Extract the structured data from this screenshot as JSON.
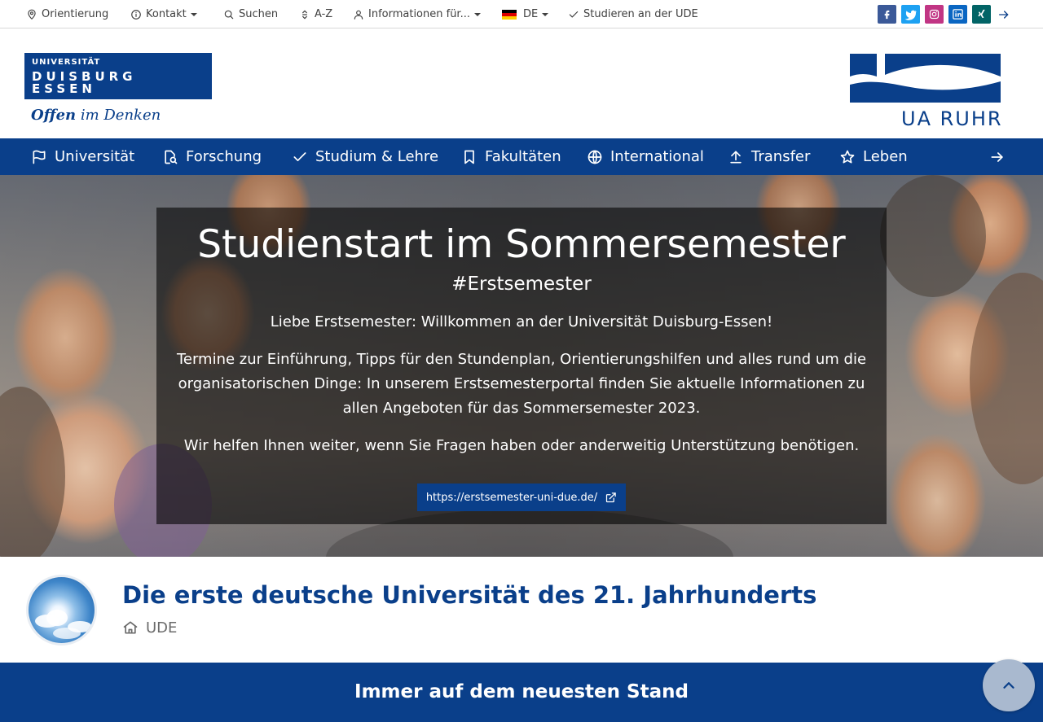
{
  "topbar": {
    "items": [
      {
        "label": "Orientierung",
        "icon": "map-pin-icon"
      },
      {
        "label": "Kontakt",
        "icon": "info-icon"
      },
      {
        "label": "Suchen",
        "icon": "search-icon"
      },
      {
        "label": "A-Z",
        "icon": "sort-icon"
      },
      {
        "label": "Informationen für...",
        "icon": "user-icon"
      },
      {
        "label": "DE",
        "icon": "german-flag-icon"
      },
      {
        "label": "Studieren an der UDE",
        "icon": "check-icon"
      }
    ],
    "social": [
      "facebook-icon",
      "twitter-icon",
      "instagram-icon",
      "linkedin-icon",
      "xing-icon"
    ]
  },
  "logo": {
    "line1": "UNIVERSITÄT",
    "line2": "DUISBURG",
    "line3": "ESSEN",
    "claim_bold": "Offen",
    "claim_rest": " im Denken",
    "partner": "UA RUHR"
  },
  "mainnav": {
    "items": [
      {
        "label": "Universität",
        "icon": "flag-icon"
      },
      {
        "label": "Forschung",
        "icon": "document-search-icon"
      },
      {
        "label": "Studium & Lehre",
        "icon": "check-icon"
      },
      {
        "label": "Fakultäten",
        "icon": "bookmark-icon"
      },
      {
        "label": "International",
        "icon": "globe-icon"
      },
      {
        "label": "Transfer",
        "icon": "upload-icon"
      },
      {
        "label": "Leben",
        "icon": "star-icon"
      }
    ]
  },
  "hero": {
    "title": "Studienstart im Sommersemester",
    "subtitle": "#Erstsemester",
    "p1": "Liebe Erstsemester: Willkommen an der Universität Duisburg-Essen!",
    "p2": "Termine zur Einführung, Tipps für den Stundenplan, Orientierungshilfen und alles rund um die organisatorischen Dinge: In unserem Erstsemesterportal finden Sie aktuelle Informationen zu allen Angeboten für das Sommersemester 2023.",
    "p3": "Wir helfen Ihnen weiter, wenn Sie Fragen haben oder anderweitig Unterstützung benötigen.",
    "link": "https://erstsemester-uni-due.de/"
  },
  "page": {
    "headline": "Die erste deutsche Universität des 21. Jahrhunderts",
    "breadcrumb": "UDE"
  },
  "band": {
    "title": "Immer auf dem neuesten Stand"
  },
  "colors": {
    "brand": "#0a3f8a",
    "facebook": "#3b5998",
    "twitter": "#1da1f2",
    "instagram": "#c13584",
    "linkedin": "#0a66c2",
    "xing": "#026466"
  }
}
